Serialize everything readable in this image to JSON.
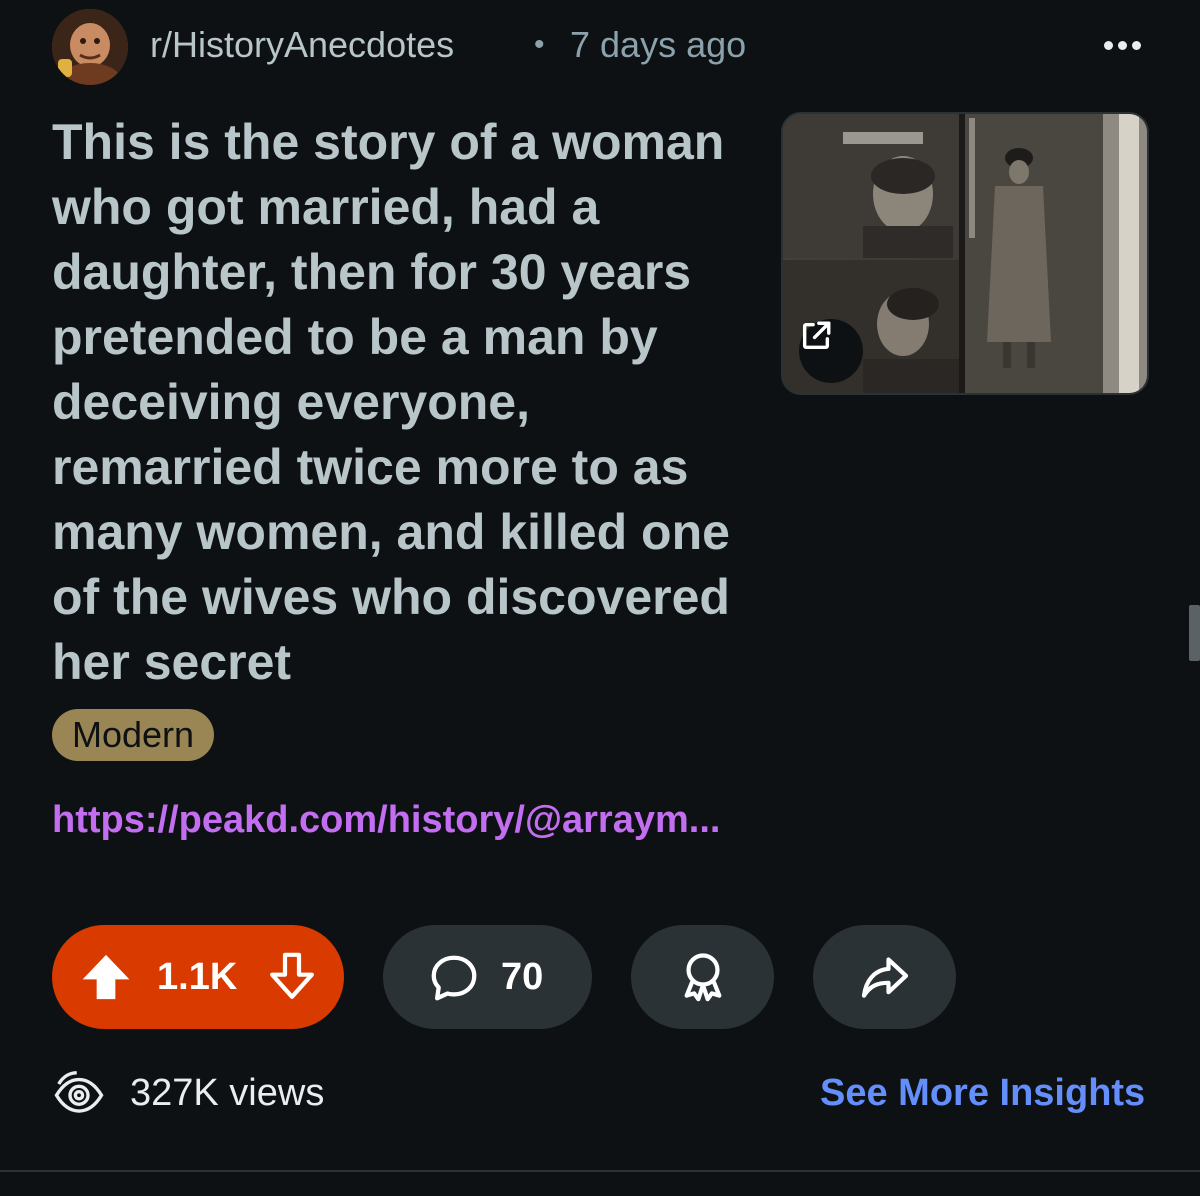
{
  "header": {
    "subreddit": "r/HistoryAnecdotes",
    "separator": "•",
    "time_ago": "7 days ago"
  },
  "post": {
    "title": "This is the story of a woman who got married, had a daughter, then for 30 years pretended to be a man by deceiving everyone, remarried twice more to as many women, and killed one of the wives who discovered her secret",
    "flair": "Modern",
    "flair_color": "#9a8554",
    "link": "https://peakd.com/history/@arraym..."
  },
  "actions": {
    "vote_count": "1.1K",
    "vote_color": "#d93a00",
    "comment_count": "70"
  },
  "stats": {
    "views": "327K views",
    "insights_label": "See More Insights"
  },
  "icons": {
    "more": "more-horizontal-icon",
    "external": "external-link-icon",
    "upvote": "upvote-arrow-icon",
    "downvote": "downvote-arrow-icon",
    "comment": "comment-bubble-icon",
    "award": "award-ribbon-icon",
    "share": "share-arrow-icon",
    "views": "eye-icon"
  }
}
